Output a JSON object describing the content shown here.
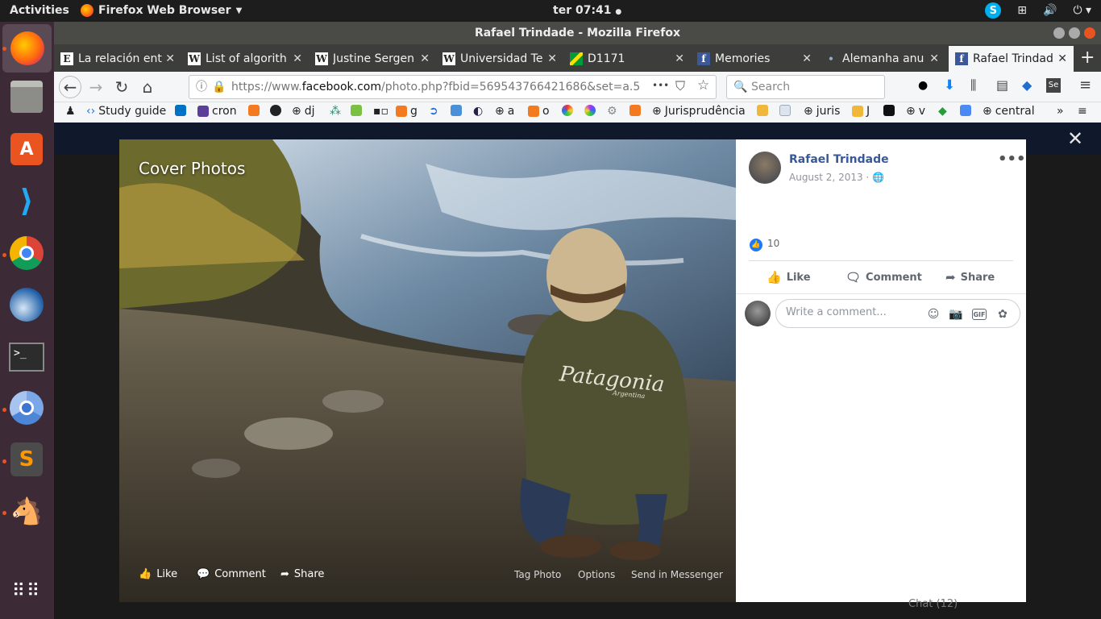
{
  "topbar": {
    "activities": "Activities",
    "app_menu": "Firefox Web Browser",
    "clock": "ter 07:41"
  },
  "window": {
    "title": "Rafael Trindade - Mozilla Firefox"
  },
  "tabs": [
    {
      "icon": "E",
      "label": "La relación ent"
    },
    {
      "icon": "W",
      "label": "List of algorith"
    },
    {
      "icon": "W",
      "label": "Justine Sergen"
    },
    {
      "icon": "W",
      "label": "Universidad Te"
    },
    {
      "icon": "flag",
      "label": "D1171"
    },
    {
      "icon": "f",
      "label": "Memories"
    },
    {
      "icon": "•",
      "label": "Alemanha anu"
    },
    {
      "icon": "f",
      "label": "Rafael Trindad"
    }
  ],
  "nav": {
    "url_prefix": "https://www.",
    "url_domain": "facebook.com",
    "url_rest": "/photo.php?fbid=569543766421686&set=a.5",
    "search_placeholder": "Search",
    "more": "•••"
  },
  "bookmarks": [
    "Study guide",
    "cron",
    "dj",
    "g",
    "a",
    "o",
    "Jurisprudência",
    "juris",
    "J",
    "v",
    "central"
  ],
  "photo": {
    "section_title": "Cover Photos",
    "like": "Like",
    "comment": "Comment",
    "share": "Share",
    "tag": "Tag Photo",
    "options": "Options",
    "send": "Send in Messenger",
    "jacket_text": "Patagonia",
    "jacket_subtext": "Argentina"
  },
  "post": {
    "author": "Rafael Trindade",
    "date": "August 2, 2013 ·",
    "menu": "•••",
    "like_count": "10",
    "like_label": "Like",
    "comment_label": "Comment",
    "share_label": "Share",
    "comment_placeholder": "Write a comment...",
    "gif": "GIF"
  },
  "colors": {
    "fb_blue": "#385898",
    "like_blue": "#2078f4",
    "ubuntu_orange": "#e95420",
    "dock_bg": "#3c2b37"
  },
  "background": {
    "chat": "Chat (12)"
  }
}
